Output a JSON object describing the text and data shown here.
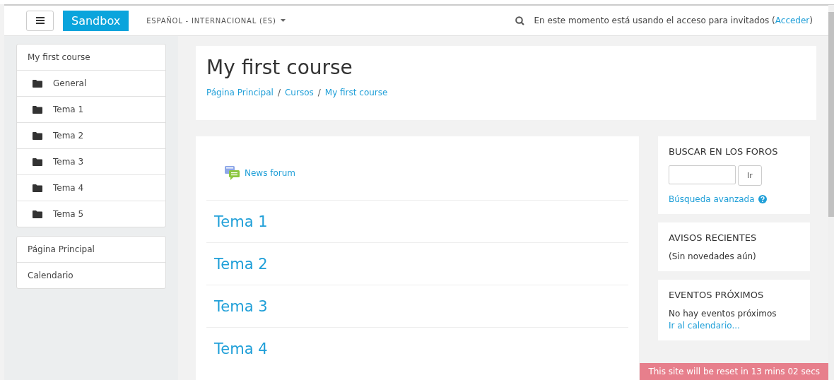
{
  "navbar": {
    "brand": "Sandbox",
    "language": "ESPAÑOL - INTERNACIONAL (ES)",
    "login_info": "En este momento está usando el acceso para invitados (",
    "login_link": "Acceder",
    "login_close": ")"
  },
  "sidebar": {
    "course_title": "My first course",
    "sections": [
      {
        "label": "General"
      },
      {
        "label": "Tema 1"
      },
      {
        "label": "Tema 2"
      },
      {
        "label": "Tema 3"
      },
      {
        "label": "Tema 4"
      },
      {
        "label": "Tema 5"
      }
    ],
    "links": [
      "Página Principal",
      "Calendario"
    ]
  },
  "page_header": {
    "title": "My first course",
    "breadcrumb": [
      "Página Principal",
      "Cursos",
      "My first course"
    ],
    "separator": "/"
  },
  "course": {
    "forum": "News forum",
    "sections": [
      "Tema 1",
      "Tema 2",
      "Tema 3",
      "Tema 4"
    ]
  },
  "blocks": {
    "search": {
      "title": "BUSCAR EN LOS FOROS",
      "button": "Ir",
      "advanced": "Búsqueda avanzada"
    },
    "news": {
      "title": "AVISOS RECIENTES",
      "text": "(Sin novedades aún)"
    },
    "events": {
      "title": "EVENTOS PRÓXIMOS",
      "text": "No hay eventos próximos",
      "link": "Ir al calendario..."
    }
  },
  "reset_notice": "This site will be reset in 13 mins 02 secs"
}
